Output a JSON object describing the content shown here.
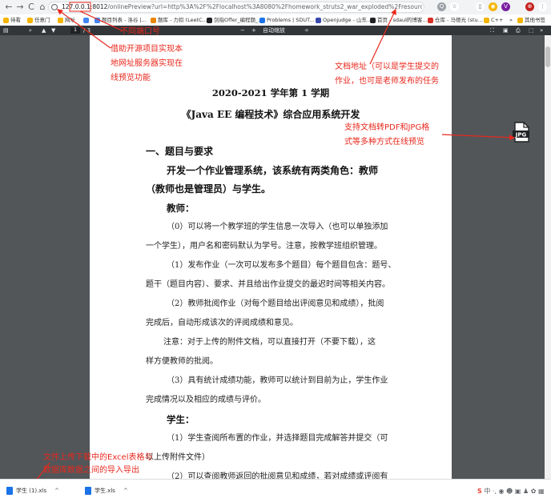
{
  "browser": {
    "url_host": "127.0.0.1:",
    "url_port": "8012",
    "url_rest": "/onlinePreview?url=http%3A%2F%2Flocalhost%3A8080%2Fhomework_struts2_war_exploded%2Fresource%2FJAVAEE编程技术期末综合应用...",
    "nav": {
      "back": "←",
      "forward": "→",
      "reload": "C",
      "home": "⌂"
    },
    "extensions": [
      "Q",
      "☆",
      "▯",
      "◉",
      "V",
      "⊕",
      "⋮"
    ]
  },
  "bookmarks": [
    {
      "label": "待看",
      "color": "#f4b400"
    },
    {
      "label": "任意门",
      "color": "#f4b400"
    },
    {
      "label": "网址",
      "color": "#f4b400"
    },
    {
      "label": "",
      "color": "#4285f4"
    },
    {
      "label": "题目列表 - 洛谷 |...",
      "color": "#4285f4"
    },
    {
      "label": "题库 - 力扣 (LeetC...",
      "color": "#ea8600"
    },
    {
      "label": "剑指Offer_编程题_...",
      "color": "#202124"
    },
    {
      "label": "Problems | SDUT...",
      "color": "#1a73e8"
    },
    {
      "label": "Openjudge - 山东...",
      "color": "#3949ab"
    },
    {
      "label": "首页 - sdaul的博客...",
      "color": "#202124"
    },
    {
      "label": "仓库 - 马德光 (stu...",
      "color": "#d93025"
    },
    {
      "label": "C++",
      "color": "#f4b400"
    },
    {
      "label": "»",
      "color": "#ffffff"
    },
    {
      "label": "其他书签",
      "color": "#f4b400"
    }
  ],
  "pdf_toolbar": {
    "page_current": "1",
    "page_total": "/ 3",
    "zoom_minus": "−",
    "zoom_plus": "+",
    "zoom_mode": "自动缩放",
    "zoom_arrow": "÷"
  },
  "document": {
    "term": "2020-2021 学年第 1 学期",
    "course": "《Java EE 编程技术》综合应用系统开发",
    "section1": "一、题目与要求",
    "intro_line1": "开发一个作业管理系统，该系统有两类角色：教师",
    "intro_line2": "（教师也是管理员）与学生。",
    "teacher_heading": "教师：",
    "teacher_items": [
      "（0）可以将一个教学班的学生信息一次导入（也可以单独添加",
      "一个学生），用户名和密码默认为学号。注意，按教学班组织管理。",
      "（1）发布作业（一次可以发布多个题目）每个题目包含：题号、",
      "题干（题目内容）、要求、并且给出作业提交的最迟时间等相关内容。",
      "（2）教师批阅作业（对每个题目给出评阅意见和成绩），批阅",
      "完成后，自动形成该次的评阅成绩和意见。",
      "注意：对于上传的附件文档，可以直接打开（不要下载），这",
      "样方便教师的批阅。",
      "（3）具有统计成绩功能，教师可以统计到目前为止，学生作业",
      "完成情况以及相应的成绩与评价。"
    ],
    "student_heading": "学生：",
    "student_items": [
      "（1）学生查阅所布置的作业，并选择题目完成解答并提交（可",
      "以上传附件文件）",
      "（2）可以查阅教师返回的批阅意见和成绩，若对成绩或评阅有"
    ]
  },
  "annotations": {
    "port_note": "不同端口号",
    "preview_note": [
      "借助开源项目实现本",
      "地网址服务器实现在",
      "线预览功能"
    ],
    "doc_address_note": [
      "文档地址（可以是学生提交的",
      "作业，也可是老师发布的任务"
    ],
    "convert_note": [
      "支持文档转PDF和JPG格",
      "式等多种方式在线预览"
    ],
    "excel_note": [
      "文件上传下载中的Excel表格与",
      "数据库数据之间的导入导出"
    ],
    "color": "#e8281e"
  },
  "jpg_icon": "JPG",
  "downloads": [
    {
      "name": "学生 (1).xls",
      "chevron": "^"
    },
    {
      "name": "学生.xls",
      "chevron": "^"
    }
  ],
  "tray_text": "中 ·, ◉ ☻ ▣ ♟ ✿ ▦"
}
